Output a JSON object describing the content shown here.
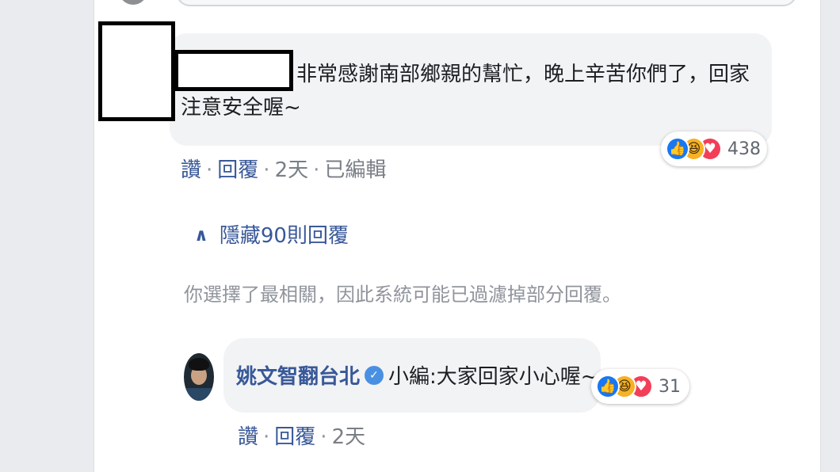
{
  "comment": {
    "text_line1": "非常感謝南部鄉親的幫忙，晚上辛苦你們了，回家",
    "text_line2": "注意安全喔~",
    "reaction_count": "438",
    "actions": {
      "like": "讚",
      "reply": "回覆",
      "time": "2天",
      "edited": "已編輯"
    }
  },
  "replies_toggle": {
    "label": "隱藏90則回覆"
  },
  "filter_note": "你選擇了最相關，因此系統可能已過濾掉部分回覆。",
  "reply": {
    "author": "姚文智翻台北",
    "text": "小編:大家回家小心喔~",
    "reaction_count": "31",
    "actions": {
      "like": "讚",
      "reply": "回覆",
      "time": "2天"
    }
  },
  "icons": [
    "like-reaction-icon",
    "haha-reaction-icon",
    "love-reaction-icon",
    "verified-badge-icon",
    "chevron-up-icon"
  ],
  "colors": {
    "link": "#385898",
    "bubble": "#f2f3f5",
    "like": "#1877f2",
    "haha": "#f7b125",
    "love": "#f33e58"
  }
}
